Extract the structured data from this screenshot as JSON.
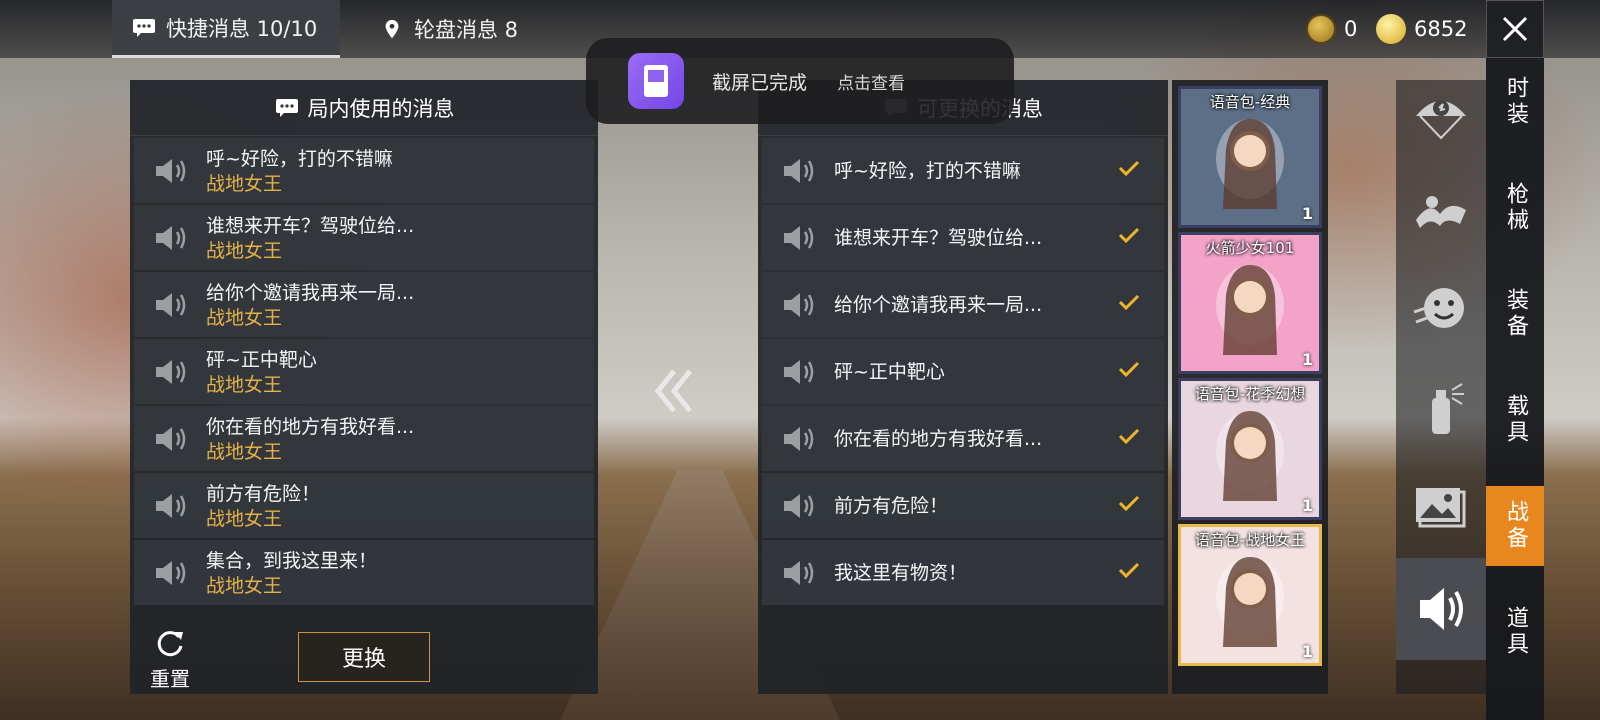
{
  "top_tabs": [
    {
      "label": "快捷消息 10/10",
      "icon": "chat-bubble-icon",
      "active": true
    },
    {
      "label": "轮盘消息 8",
      "icon": "location-pin-icon",
      "active": false
    }
  ],
  "currency": {
    "coin_a": "0",
    "coin_b": "6852"
  },
  "left_panel": {
    "title": "局内使用的消息",
    "messages": [
      {
        "text": "呼~好险，打的不错嘛",
        "source": "战地女王"
      },
      {
        "text": "谁想来开车？驾驶位给...",
        "source": "战地女王"
      },
      {
        "text": "给你个邀请我再来一局...",
        "source": "战地女王"
      },
      {
        "text": "砰~正中靶心",
        "source": "战地女王"
      },
      {
        "text": "你在看的地方有我好看...",
        "source": "战地女王"
      },
      {
        "text": "前方有危险！",
        "source": "战地女王"
      },
      {
        "text": "集合，到我这里来！",
        "source": "战地女王"
      }
    ],
    "reset_label": "重置",
    "swap_label": "更换"
  },
  "right_panel": {
    "title": "可更换的消息",
    "messages": [
      {
        "text": "呼~好险，打的不错嘛"
      },
      {
        "text": "谁想来开车？驾驶位给..."
      },
      {
        "text": "给你个邀请我再来一局..."
      },
      {
        "text": "砰~正中靶心"
      },
      {
        "text": "你在看的地方有我好看..."
      },
      {
        "text": "前方有危险！"
      },
      {
        "text": "我这里有物资！"
      }
    ]
  },
  "notification": {
    "text": "截屏已完成",
    "action": "点击查看"
  },
  "voice_packs": [
    {
      "label": "语音包-经典",
      "count": "1",
      "bg": "#5d6f86"
    },
    {
      "label": "火箭少女101",
      "count": "1",
      "bg": "#f3a2c8"
    },
    {
      "label": "语音包-花季幻想",
      "count": "1",
      "bg": "#e9d6df"
    },
    {
      "label": "语音包-战地女王",
      "count": "1",
      "bg": "#f4e2e2"
    }
  ],
  "category_icons": [
    "parachute-icon",
    "emote-pose-icon",
    "sticker-face-icon",
    "spray-can-icon",
    "gallery-icon",
    "speaker-icon"
  ],
  "category_menu": [
    {
      "label": "时装",
      "active": false
    },
    {
      "label": "枪械",
      "active": false
    },
    {
      "label": "装备",
      "active": false
    },
    {
      "label": "载具",
      "active": false
    },
    {
      "label": "战备",
      "active": true
    },
    {
      "label": "道具",
      "active": false
    }
  ],
  "colors": {
    "accent": "#e8871e",
    "gold_text": "#e4b248",
    "check": "#f0b428"
  }
}
